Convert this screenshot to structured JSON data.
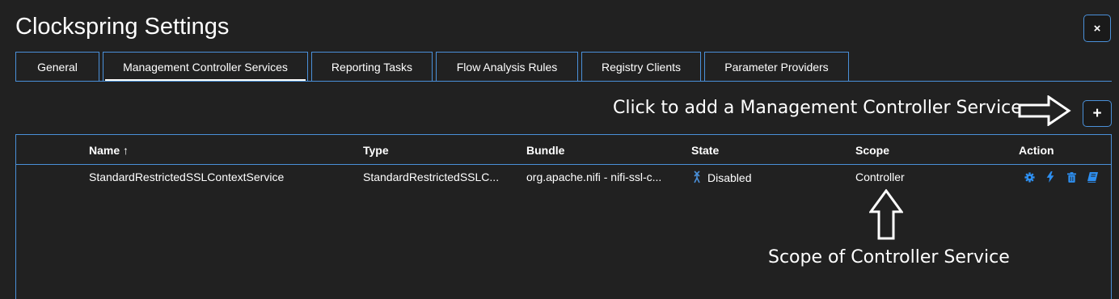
{
  "dialog": {
    "title": "Clockspring Settings",
    "close_label": "×"
  },
  "tabs": [
    {
      "label": "General"
    },
    {
      "label": "Management Controller Services",
      "active": true
    },
    {
      "label": "Reporting Tasks"
    },
    {
      "label": "Flow Analysis Rules"
    },
    {
      "label": "Registry Clients"
    },
    {
      "label": "Parameter Providers"
    }
  ],
  "toolbar": {
    "add_hint": "Click to add a Management Controller Service",
    "add_label": "+"
  },
  "table": {
    "columns": {
      "name": "Name ↑",
      "type": "Type",
      "bundle": "Bundle",
      "state": "State",
      "scope": "Scope",
      "action": "Action"
    },
    "rows": [
      {
        "name": "StandardRestrictedSSLContextService",
        "type": "StandardRestrictedSSLC...",
        "bundle": "org.apache.nifi - nifi-ssl-c...",
        "state": "Disabled",
        "scope": "Controller",
        "actions": [
          "gear-icon",
          "bolt-icon",
          "trash-icon",
          "book-icon"
        ]
      }
    ]
  },
  "annotations": {
    "scope_caption": "Scope of Controller Service"
  },
  "colors": {
    "accent": "#4a90d9",
    "background": "#212121",
    "action_icon": "#2e8ff0"
  }
}
